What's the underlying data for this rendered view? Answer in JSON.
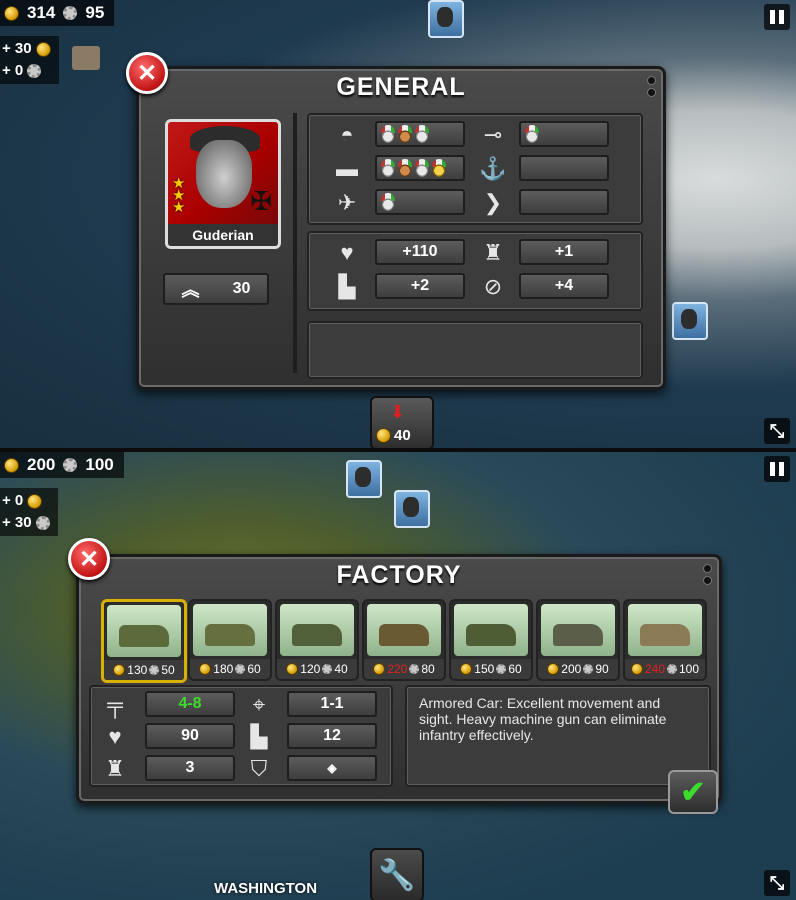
{
  "top": {
    "resources": {
      "gold": "314",
      "industry": "95"
    },
    "income": {
      "gold": "+ 30",
      "industry": "+ 0"
    },
    "general_panel": {
      "title": "GENERAL",
      "general_name": "Guderian",
      "rank_value": "30",
      "medal_rows": [
        {
          "icon": "infantry-helmet-icon",
          "medals": [
            "silver",
            "bronze",
            "silver"
          ]
        },
        {
          "icon": "artillery-icon",
          "medals": [
            "silver"
          ]
        },
        {
          "icon": "tank-icon",
          "medals": [
            "silver",
            "bronze",
            "silver",
            "gold"
          ]
        },
        {
          "icon": "navy-anchor-icon",
          "medals": []
        },
        {
          "icon": "airplane-icon",
          "medals": [
            "silver"
          ]
        },
        {
          "icon": "rank-chevron-icon",
          "medals": []
        }
      ],
      "bonuses": {
        "health": "+110",
        "fortification": "+1",
        "movement": "+2",
        "supply": "+4"
      }
    },
    "deploy_cost": "40"
  },
  "bottom": {
    "resources": {
      "gold": "200",
      "industry": "100"
    },
    "income": {
      "gold": "+ 0",
      "industry": "+ 30"
    },
    "factory_panel": {
      "title": "FACTORY",
      "units": [
        {
          "name": "armored-car",
          "gold": "130",
          "industry": "50",
          "gold_affordable": true,
          "selected": true,
          "color": "#5d6a3b"
        },
        {
          "name": "light-tank",
          "gold": "180",
          "industry": "60",
          "gold_affordable": true,
          "selected": false,
          "color": "#66703f"
        },
        {
          "name": "anti-tank-gun",
          "gold": "120",
          "industry": "40",
          "gold_affordable": true,
          "selected": false,
          "color": "#52603a"
        },
        {
          "name": "medium-tank",
          "gold": "220",
          "industry": "80",
          "gold_affordable": false,
          "selected": false,
          "color": "#6a5a33"
        },
        {
          "name": "field-artillery",
          "gold": "150",
          "industry": "60",
          "gold_affordable": true,
          "selected": false,
          "color": "#4f5d35"
        },
        {
          "name": "rocket-truck",
          "gold": "200",
          "industry": "90",
          "gold_affordable": true,
          "selected": false,
          "color": "#5b5f4a"
        },
        {
          "name": "heavy-tank",
          "gold": "240",
          "industry": "100",
          "gold_affordable": false,
          "selected": false,
          "color": "#8a7a55"
        }
      ],
      "stats": {
        "attack": "4-8",
        "range": "1-1",
        "health": "90",
        "movement": "12",
        "fortification": "3",
        "armor": ""
      },
      "description": "Armored Car: Excellent movement and sight. Heavy machine gun can eliminate infantry effectively."
    },
    "map_label": "WASHINGTON"
  },
  "colors": {
    "accent_gold": "#d7b200",
    "attack_green": "#3bdc2a",
    "unaffordable_red": "#e32222"
  }
}
